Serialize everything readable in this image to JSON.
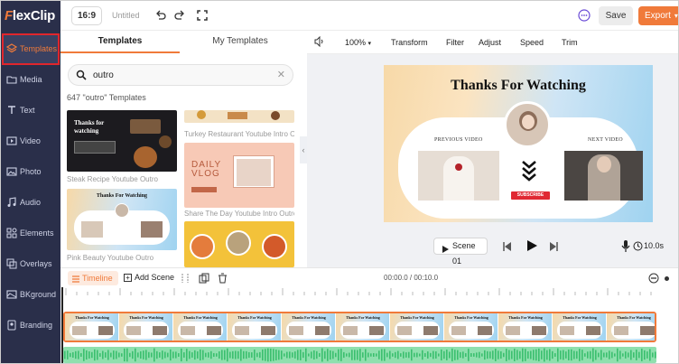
{
  "app": {
    "logo_first": "F",
    "logo_rest": "lexClip"
  },
  "sidebar": {
    "items": [
      {
        "label": "Templates",
        "icon": "layers-icon"
      },
      {
        "label": "Media",
        "icon": "folder-icon"
      },
      {
        "label": "Text",
        "icon": "text-icon"
      },
      {
        "label": "Video",
        "icon": "video-icon"
      },
      {
        "label": "Photo",
        "icon": "photo-icon"
      },
      {
        "label": "Audio",
        "icon": "music-icon"
      },
      {
        "label": "Elements",
        "icon": "shapes-icon"
      },
      {
        "label": "Overlays",
        "icon": "overlay-icon"
      },
      {
        "label": "BKground",
        "icon": "background-icon"
      },
      {
        "label": "Branding",
        "icon": "brand-icon"
      }
    ],
    "active": "Templates"
  },
  "topbar": {
    "ratio": "16:9",
    "title": "Untitled",
    "save": "Save",
    "export": "Export"
  },
  "panel": {
    "tabs": [
      "Templates",
      "My Templates"
    ],
    "search_value": "outro",
    "result_count": "647 \"outro\" Templates",
    "templates": [
      {
        "caption": "Steak Recipe Youtube Outro",
        "text": "Thanks for watching"
      },
      {
        "caption": "Turkey Restaurant Youtube Intro Outro",
        "text": ""
      },
      {
        "caption": "Share The Day Youtube Intro Outro",
        "text": "DAILY VLOG"
      },
      {
        "caption": "Pink Beauty Youtube Outro",
        "text": "Thanks For Watching"
      }
    ]
  },
  "editor_toolbar": {
    "zoom": "100%",
    "items": [
      "Transform",
      "Filter",
      "Adjust",
      "Speed",
      "Trim"
    ]
  },
  "canvas": {
    "title": "Thanks For Watching",
    "previous_label": "PREVIOUS VIDEO",
    "next_label": "NEXT VIDEO",
    "subscribe": "SUBSCRIBE"
  },
  "playbar": {
    "scene": "Scene 01",
    "duration": "10.0s"
  },
  "timeline": {
    "tab": "Timeline",
    "add_scene": "Add Scene",
    "timecode": "00:00.0 / 00:10.0",
    "frame_title": "Thanks For Watching",
    "frame_count": 11
  },
  "colors": {
    "accent": "#f07a3a",
    "sidebar": "#2a2f4a",
    "highlight": "#e0262c"
  }
}
